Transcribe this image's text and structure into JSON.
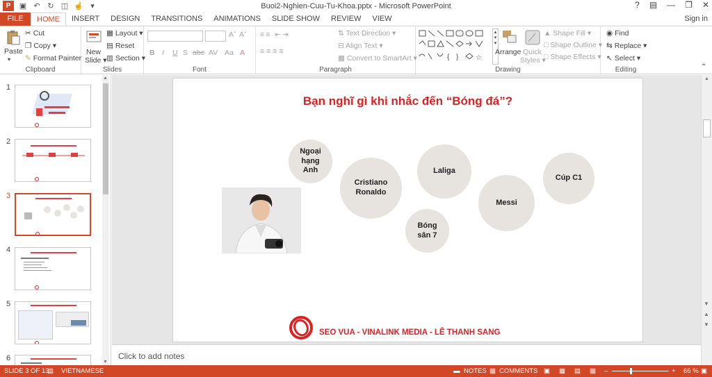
{
  "window": {
    "title": "Buoi2-Nghien-Cuu-Tu-Khoa.pptx - Microsoft PowerPoint",
    "help": "?",
    "app_badge": "P"
  },
  "tabs": [
    "FILE",
    "HOME",
    "INSERT",
    "DESIGN",
    "TRANSITIONS",
    "ANIMATIONS",
    "SLIDE SHOW",
    "REVIEW",
    "VIEW"
  ],
  "signin": "Sign in",
  "ribbon": {
    "clipboard": {
      "paste": "Paste",
      "cut": "Cut",
      "copy": "Copy",
      "format_painter": "Format Painter",
      "label": "Clipboard"
    },
    "slides": {
      "new_slide_1": "New",
      "new_slide_2": "Slide",
      "layout": "Layout",
      "reset": "Reset",
      "section": "Section",
      "label": "Slides"
    },
    "font": {
      "label": "Font"
    },
    "paragraph": {
      "text_direction": "Text Direction",
      "align_text": "Align Text",
      "convert": "Convert to SmartArt",
      "label": "Paragraph"
    },
    "drawing": {
      "arrange": "Arrange",
      "quick_styles_1": "Quick",
      "quick_styles_2": "Styles",
      "shape_fill": "Shape Fill",
      "shape_outline": "Shape Outline",
      "shape_effects": "Shape Effects",
      "label": "Drawing"
    },
    "editing": {
      "find": "Find",
      "replace": "Replace",
      "select": "Select",
      "label": "Editing"
    }
  },
  "thumbnails": [
    {
      "num": "1",
      "active": false
    },
    {
      "num": "2",
      "active": false
    },
    {
      "num": "3",
      "active": true
    },
    {
      "num": "4",
      "active": false
    },
    {
      "num": "5",
      "active": false
    },
    {
      "num": "6",
      "active": false
    }
  ],
  "slide": {
    "title": "Bạn nghĩ gì khi nhắc đến “Bóng đá”?",
    "bubbles": [
      {
        "line1": "Ngoại",
        "line2": "hạng",
        "line3": "Anh"
      },
      {
        "line1": "Cristiano",
        "line2": "Ronaldo"
      },
      {
        "line1": "Laliga"
      },
      {
        "line1": "Cúp C1"
      },
      {
        "line1": "Messi"
      },
      {
        "line1": "Bóng",
        "line2": "sân 7"
      }
    ],
    "footer": "SEO VUA - VINALINK MEDIA - LÊ THANH SANG"
  },
  "notes_placeholder": "Click to add notes",
  "status": {
    "slide": "SLIDE 3 OF 13",
    "language": "VIETNAMESE",
    "notes": "NOTES",
    "comments": "COMMENTS",
    "zoom": "66 %"
  },
  "colors": {
    "accent": "#d24726",
    "title_red": "#e02020",
    "bubble": "#e7e3de"
  }
}
